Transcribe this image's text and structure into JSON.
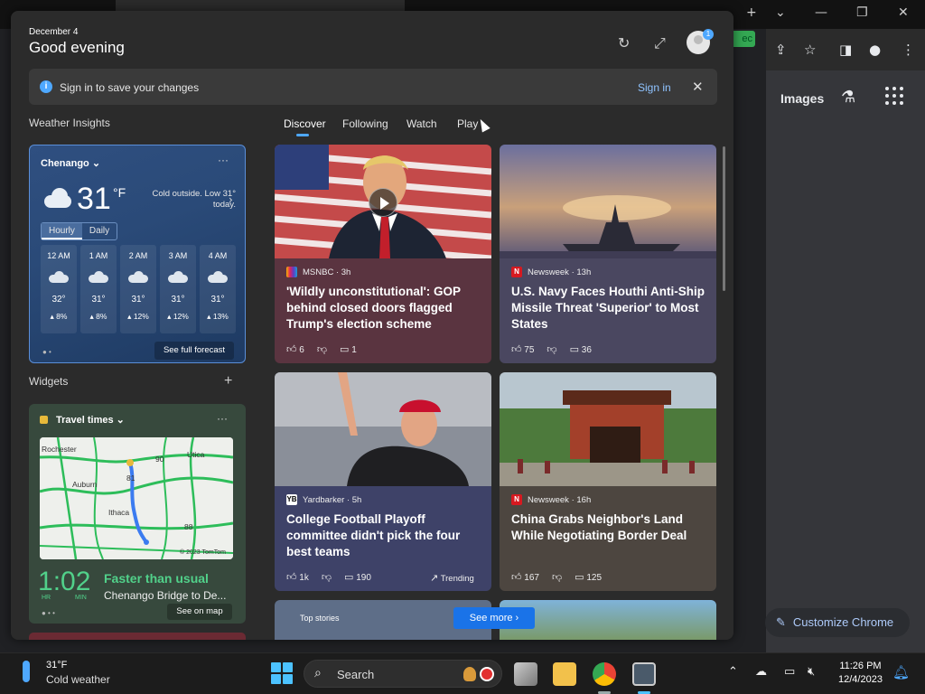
{
  "chrome": {
    "images_label": "Images",
    "customize_label": "Customize Chrome",
    "green_badge": "ec",
    "controls": {
      "new_tab": "+",
      "tab_menu": "⌄",
      "minimize": "—",
      "restore": "❐",
      "close": "✕"
    }
  },
  "widgets_panel": {
    "date": "December 4",
    "greeting": "Good evening",
    "profile_badge": "1",
    "signin_bar": {
      "message": "Sign in to save your changes",
      "action": "Sign in"
    },
    "weather_section_title": "Weather Insights",
    "feed_tabs": [
      {
        "label": "Discover",
        "active": true
      },
      {
        "label": "Following",
        "active": false
      },
      {
        "label": "Watch",
        "active": false
      },
      {
        "label": "Play",
        "active": false
      }
    ],
    "weather": {
      "location": "Chenango",
      "temperature": "31",
      "unit": "°F",
      "description": "Cold outside. Low 31° today.",
      "tabs": [
        "Hourly",
        "Daily"
      ],
      "active_tab": "Hourly",
      "hours": [
        {
          "time": "12 AM",
          "temp": "32°",
          "precip": "8%"
        },
        {
          "time": "1 AM",
          "temp": "31°",
          "precip": "8%"
        },
        {
          "time": "2 AM",
          "temp": "31°",
          "precip": "12%"
        },
        {
          "time": "3 AM",
          "temp": "31°",
          "precip": "12%"
        },
        {
          "time": "4 AM",
          "temp": "31°",
          "precip": "13%"
        }
      ],
      "full_forecast_label": "See full forecast"
    },
    "widgets_section_title": "Widgets",
    "travel": {
      "title": "Travel times",
      "hours": "1",
      "minutes": "02",
      "hr_label": "HR",
      "min_label": "MIN",
      "status": "Faster than usual",
      "route": "Chenango Bridge to De...",
      "see_on_map": "See on map",
      "map_labels": {
        "rochester": "Rochester",
        "utica": "Utica",
        "auburn": "Auburn",
        "ithaca": "Ithaca",
        "copyright": "© 2023 TomTom",
        "road_90": "90",
        "road_81": "81",
        "road_88": "88"
      }
    },
    "cards": [
      {
        "source": "MSNBC · 3h",
        "title": "'Wildly unconstitutional': GOP behind closed doors flagged Trump's election scheme",
        "likes": "6",
        "comments": "1",
        "trending": ""
      },
      {
        "source": "Newsweek · 13h",
        "title": "U.S. Navy Faces Houthi Anti-Ship Missile Threat 'Superior' to Most States",
        "likes": "75",
        "comments": "36",
        "trending": ""
      },
      {
        "source": "Yardbarker · 5h",
        "title": "College Football Playoff committee didn't pick the four best teams",
        "likes": "1k",
        "comments": "190",
        "trending": "Trending"
      },
      {
        "source": "Newsweek · 16h",
        "title": "China Grabs Neighbor's Land While Negotiating Border Deal",
        "likes": "167",
        "comments": "125",
        "trending": ""
      }
    ],
    "top_stories_label": "Top stories",
    "see_more_label": "See more"
  },
  "taskbar": {
    "weather_temp": "31°F",
    "weather_desc": "Cold weather",
    "search_placeholder": "Search",
    "time": "11:26 PM",
    "date": "12/4/2023"
  }
}
